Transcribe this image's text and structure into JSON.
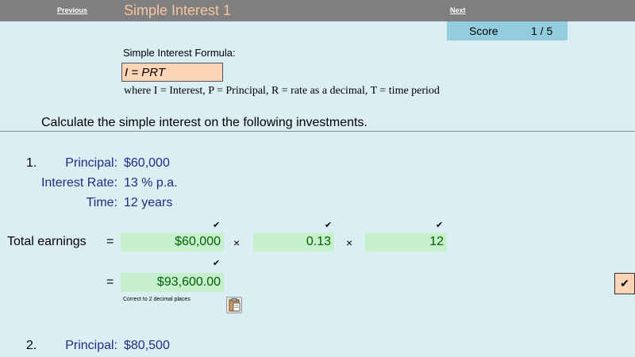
{
  "nav": {
    "previous": "Previous",
    "next": "Next",
    "title": "Simple Interest 1"
  },
  "score": {
    "label": "Score",
    "value": "1 / 5"
  },
  "formula": {
    "caption": "Simple Interest Formula:",
    "expression": "I = PRT",
    "where_text": "where I = Interest, P = Principal, R = rate as a decimal, T = time period"
  },
  "instruction": "Calculate the simple interest on the following investments.",
  "q1": {
    "number": "1.",
    "principal_label": "Principal:",
    "principal_value": "$60,000",
    "rate_label": "Interest Rate:",
    "rate_value": "13 % p.a.",
    "time_label": "Time:",
    "time_value": "12 years",
    "total_label": "Total earnings",
    "eq1": "=",
    "eq2": "=",
    "times": "×",
    "check": "✔",
    "field_principal": "$60,000",
    "field_rate": "0.13",
    "field_time": "12",
    "field_result": "$93,600.00",
    "note": "Correct to 2 decimal places",
    "result_mark": "✔"
  },
  "q2": {
    "number": "2.",
    "principal_label": "Principal:",
    "principal_value": "$80,500"
  }
}
